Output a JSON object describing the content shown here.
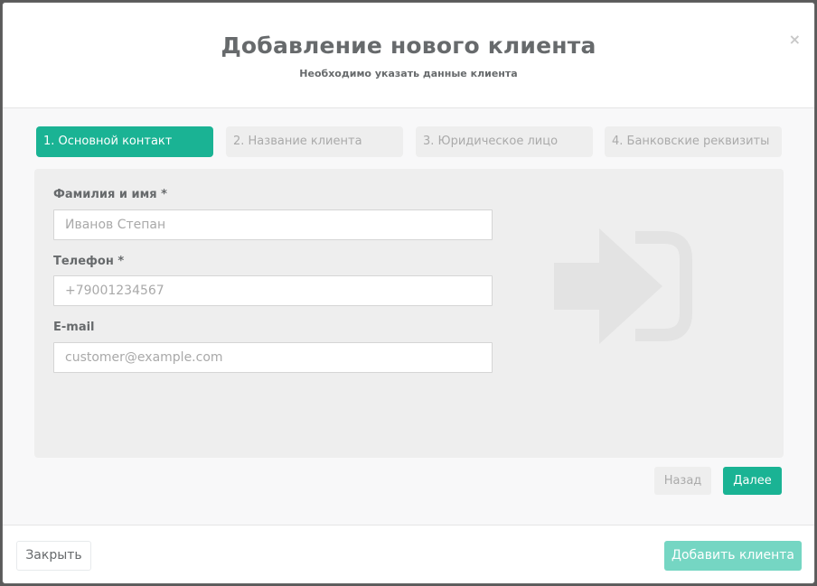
{
  "header": {
    "title": "Добавление нового клиента",
    "subtitle": "Необходимо указать данные клиента",
    "close_symbol": "×"
  },
  "steps": [
    {
      "label": "1. Основной контакт",
      "active": true
    },
    {
      "label": "2. Название клиента",
      "active": false
    },
    {
      "label": "3. Юридическое лицо",
      "active": false
    },
    {
      "label": "4. Банковские реквизиты",
      "active": false
    }
  ],
  "form": {
    "name_label": "Фамилия и имя *",
    "name_placeholder": "Иванов Степан",
    "phone_label": "Телефон *",
    "phone_placeholder": "+79001234567",
    "email_label": "E-mail",
    "email_placeholder": "customer@example.com"
  },
  "icon": "sign-in-icon",
  "nav": {
    "back_label": "Назад",
    "next_label": "Далее"
  },
  "footer": {
    "close_label": "Закрыть",
    "add_label": "Добавить клиента"
  },
  "colors": {
    "accent": "#1ab394",
    "accent_disabled": "#75d6c3",
    "step_inactive_bg": "#eeeeee",
    "step_inactive_text": "#aaaaaa"
  }
}
